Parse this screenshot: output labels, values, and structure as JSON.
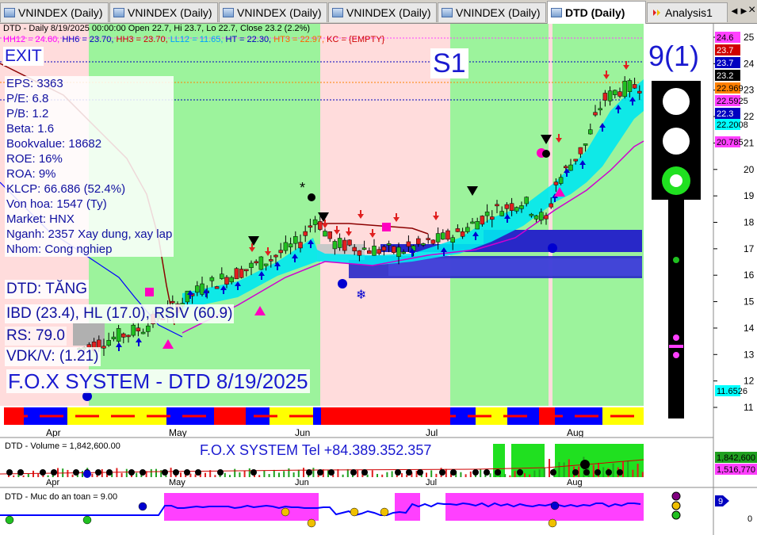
{
  "tabs": [
    {
      "label": "VNINDEX (Daily)",
      "active": false
    },
    {
      "label": "VNINDEX (Daily)",
      "active": false
    },
    {
      "label": "VNINDEX (Daily)",
      "active": false
    },
    {
      "label": "VNINDEX (Daily)",
      "active": false
    },
    {
      "label": "VNINDEX (Daily)",
      "active": false
    },
    {
      "label": "DTD (Daily)",
      "active": true
    },
    {
      "label": "Analysis1",
      "active": false
    }
  ],
  "tab_controls": {
    "prev": "◄",
    "next": "►",
    "close": "×"
  },
  "header": {
    "line1": "DTD - Daily 8/19/2025 00:00:00 Open 22.7, Hi 23.7, Lo 22.7, Close 23.2 (2.2%)",
    "hh12": "HH12 = 24.60,",
    "hh6": "HH6 = 23.70,",
    "hh3": "HH3 = 23.70,",
    "ll12": "LL12 = 11.65,",
    "ht": "HT = 22.30,",
    "ht3": "HT3 = 22.97,",
    "kc": "KC = {EMPTY}"
  },
  "overlay": {
    "exit": "EXIT",
    "s1": "S1",
    "signal": "9(1)",
    "fundamentals": [
      "EPS: 3363",
      "P/E: 6.8",
      "P/B: 1.2",
      "Beta: 1.6",
      "Bookvalue: 18682",
      "ROE: 16%",
      "ROA: 9%",
      "KLCP: 66.686 (52.4%)",
      "Von hoa: 1547 (Ty)",
      "Market: HNX",
      "Nganh: 2357 Xay dung, xay lap",
      "Nhom: Cong nghiep"
    ],
    "dtd_status": "DTD: TĂNG",
    "ibd": "IBD (23.4), HL (17.0), RSIV (60.9)",
    "rs": "RS: 79.0",
    "vdk": "VDK/V:  (1.21)",
    "fox_title": "F.O.X SYSTEM - DTD 8/19/2025",
    "fox_tel": "F.O.X SYSTEM Tel +84.389.352.357"
  },
  "price_axis": {
    "ticks": [
      "25",
      "24",
      "23",
      "22",
      "21",
      "20",
      "19",
      "18",
      "17",
      "16",
      "15",
      "14",
      "13",
      "12",
      "11"
    ],
    "tags": [
      {
        "text": "24.6",
        "bg": "#ff40ff",
        "fg": "#000"
      },
      {
        "text": "23.7",
        "bg": "#d00000",
        "fg": "#fff"
      },
      {
        "text": "23.7",
        "bg": "#0000c0",
        "fg": "#fff"
      },
      {
        "text": "23.2",
        "bg": "#000000",
        "fg": "#fff"
      },
      {
        "text": "22.969",
        "bg": "#ff8000",
        "fg": "#000"
      },
      {
        "text": "22.5925",
        "bg": "#ff40ff",
        "fg": "#000"
      },
      {
        "text": "22.3",
        "bg": "#0000c0",
        "fg": "#fff"
      },
      {
        "text": "22.2008",
        "bg": "#00ffff",
        "fg": "#000"
      },
      {
        "text": "20.785",
        "bg": "#ff40ff",
        "fg": "#000"
      },
      {
        "text": "11.6526",
        "bg": "#00ffff",
        "fg": "#000"
      }
    ]
  },
  "months": [
    "Apr",
    "May",
    "Jun",
    "Jul",
    "Aug"
  ],
  "volume_panel": {
    "title": "DTD - Volume = 1,842,600.00",
    "tag1": "1,842,600",
    "tag2": "1,516,770"
  },
  "safety_panel": {
    "title": "DTD - Muc do an toan = 9.00",
    "tag": "9",
    "axis_zero": "0"
  },
  "colors": {
    "green_zone": "#9cf39c",
    "pink_zone": "#ffdcdc",
    "blue_band": "#2828c8",
    "cyan_band": "#00ffff"
  }
}
